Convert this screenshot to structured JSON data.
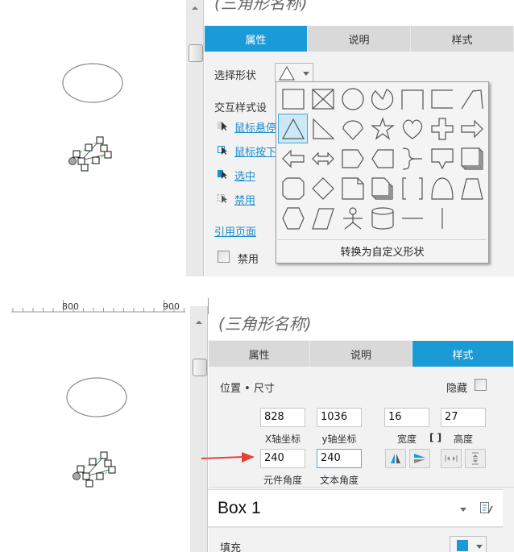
{
  "panel1": {
    "element_title": "(三角形名称)",
    "tabs": [
      {
        "label": "属性",
        "active": true
      },
      {
        "label": "说明",
        "active": false
      },
      {
        "label": "样式",
        "active": false
      }
    ],
    "select_shape_label": "选择形状",
    "interaction_styles_label": "交互样式设",
    "interaction_styles": [
      {
        "label": "鼠标悬停",
        "icon": "cursor-hover-icon"
      },
      {
        "label": "鼠标按下",
        "icon": "cursor-press-icon"
      },
      {
        "label": "选中",
        "icon": "cursor-selected-icon"
      },
      {
        "label": "禁用",
        "icon": "cursor-disabled-icon"
      }
    ],
    "reference_page_link": "引用页面",
    "disabled_checkbox_label": "禁用",
    "disabled_checked": false,
    "shape_picker": {
      "selected": "triangle",
      "shapes": [
        "rectangle",
        "placeholder",
        "ellipse",
        "pie",
        "bracket-top",
        "bracket-left",
        "slanted-corner",
        "triangle",
        "right-triangle",
        "teardrop",
        "star",
        "heart",
        "plus",
        "arrow-right",
        "arrow-left",
        "arrow-double",
        "pentagon-right",
        "pentagon-left",
        "brace-right",
        "callout-down",
        "stacked-rectangles",
        "octagon",
        "diamond",
        "page-folded",
        "stacked-pages",
        "brackets",
        "bell",
        "trapezoid",
        "hexagon",
        "parallelogram",
        "actor",
        "cylinder",
        "horizontal-line",
        "vertical-line"
      ],
      "convert_button_label": "转换为自定义形状"
    }
  },
  "panel2": {
    "ruler_labels": [
      "800",
      "900"
    ],
    "element_title": "(三角形名称)",
    "tabs": [
      {
        "label": "属性",
        "active": false
      },
      {
        "label": "说明",
        "active": false
      },
      {
        "label": "样式",
        "active": true
      }
    ],
    "position_size_label": "位置 • 尺寸",
    "hide_label": "隐藏",
    "hide_checked": false,
    "x": {
      "value": "828",
      "label": "X轴坐标"
    },
    "y": {
      "value": "1036",
      "label": "y轴坐标"
    },
    "width": {
      "value": "16",
      "label": "宽度"
    },
    "height": {
      "value": "27",
      "label": "高度"
    },
    "rotation": {
      "value": "240",
      "label": "元件角度"
    },
    "text_rotation": {
      "value": "240",
      "label": "文本角度"
    },
    "style_name": "Box 1",
    "fill_label": "填充",
    "fill_color": "#1a9bd7",
    "annotation_arrow_color": "#e8413c"
  },
  "colors": {
    "accent": "#1a9bd7",
    "link": "#1a8fcf",
    "tab_inactive": "#d9d9d9",
    "panel_bg": "#f2f2f2"
  }
}
